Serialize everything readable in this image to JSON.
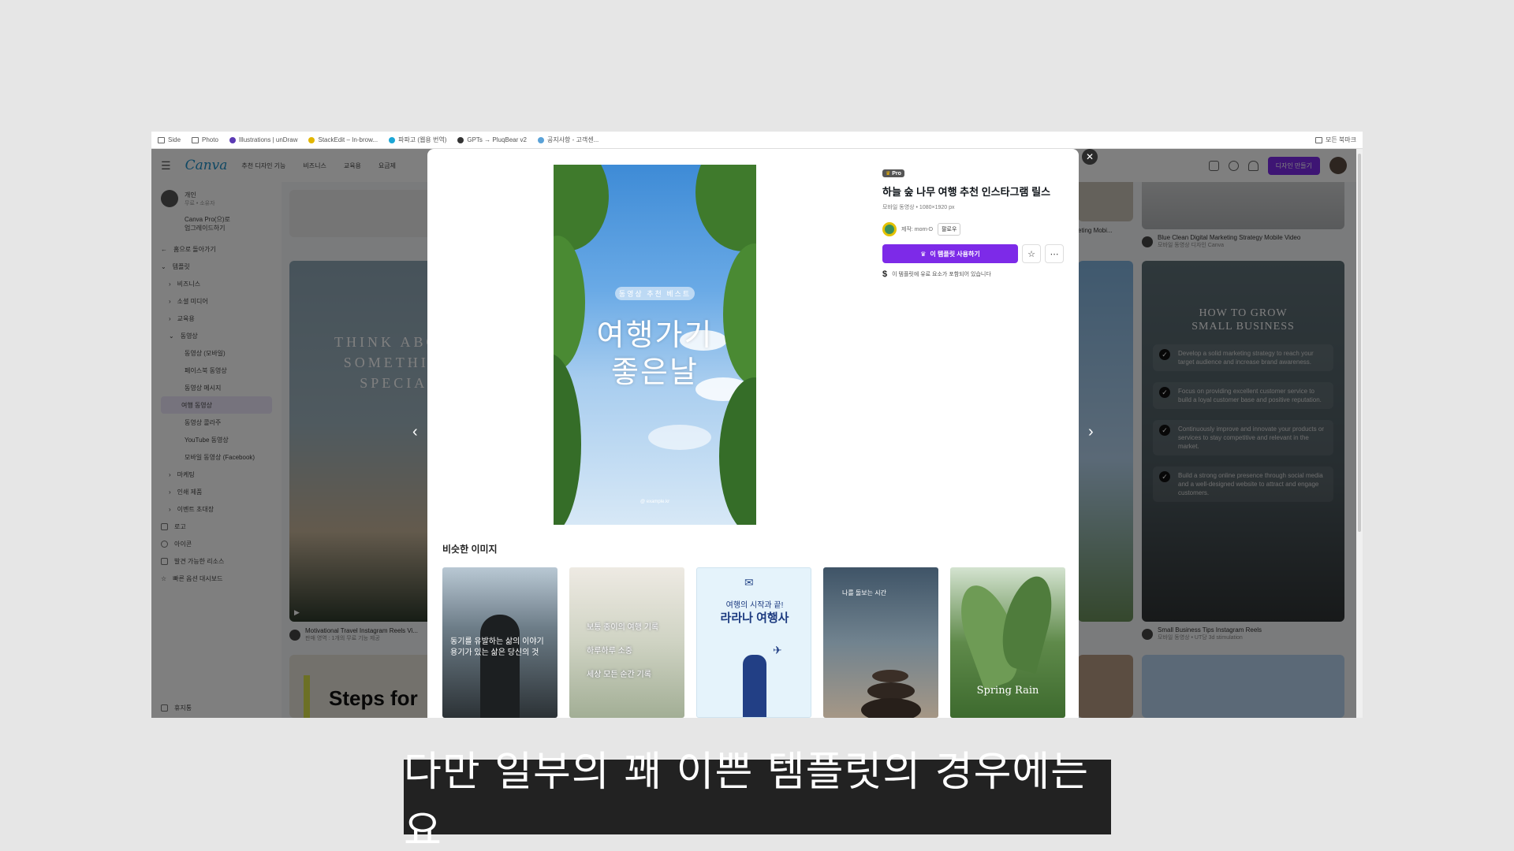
{
  "bookmarks": [
    {
      "label": "Side",
      "icon": "folder-icon"
    },
    {
      "label": "Photo",
      "icon": "folder-icon"
    },
    {
      "label": "Illustrations | unDraw",
      "icon": "undraw-icon"
    },
    {
      "label": "StackEdit – In-brow...",
      "icon": "stackedit-icon"
    },
    {
      "label": "파파고 (웹용 번역)",
      "icon": "papago-icon"
    },
    {
      "label": "GPTs → PluqBear v2",
      "icon": "globe-icon"
    },
    {
      "label": "공지사항 - 고객센...",
      "icon": "site-icon"
    }
  ],
  "bookmarks_other": "모든 북마크",
  "topbar": {
    "logo": "Canva",
    "nav": [
      "추천 디자인 기능",
      "비즈니스",
      "교육용",
      "요금제"
    ],
    "create_label": "디자인 만들기"
  },
  "sidebar": {
    "profile_name": "개인",
    "profile_sub": "무료 • 소유자",
    "upgrade": "Canva Pro(으)로\n업그레이드하기",
    "back": "홈으로 돌아가기",
    "items": [
      "템플릿",
      "비즈니스",
      "소셜 미디어",
      "교육용",
      "동영상",
      "동영상 (모바일)",
      "페이스북 동영상",
      "동영상 메시지",
      "여행 동영상",
      "동영상 콜라주",
      "YouTube 동영상",
      "모바일 동영상 (Facebook)",
      "마케팅",
      "인쇄 제품",
      "이벤트 초대장",
      "로고",
      "아이콘",
      "발견 가능한 리소스",
      "빠른 옵션 대시보드"
    ],
    "active_index": 8,
    "footer": "휴지통"
  },
  "background": {
    "think_text": "THINK ABOUT\nSOMETHING\nSPECIAL",
    "think_caption": "Motivational Travel Instagram Reels Vi...",
    "think_sub": "판매 영역 : 1개의 무료 기능 제공",
    "steps_text": "Steps for",
    "top_right_caption": "Blue Clean Digital Marketing Strategy Mobile Video",
    "top_right_sub": "모바일 동영상 디자인 Canva",
    "partial_caption": "eting Mobi...",
    "grow_title": "HOW TO GROW\nSMALL BUSINESS",
    "grow_items": [
      "Develop a solid marketing strategy to reach your target audience and increase brand awareness.",
      "Focus on providing excellent customer service to build a loyal customer base and positive reputation.",
      "Continuously improve and innovate your products or services to stay competitive and relevant in the market.",
      "Build a strong online presence through social media and a well-designed website to attract and engage customers."
    ],
    "grow_caption": "Small Business Tips Instagram Reels",
    "grow_sub": "모바일 동영상 • UT당 3d stimulation"
  },
  "modal": {
    "badge": "Pro",
    "title": "하늘 숲 나무 여행 추천 인스타그램 릴스",
    "meta": "모바일 동영상 • 1080×1920 px",
    "creator": "제작: morn-D",
    "follow": "팔로우",
    "use_button": "이 템플릿 사용하기",
    "notice": "이 템플릿에 유료 요소가 포함되어 있습니다",
    "preview_pill": "동영상 추천 베스트",
    "preview_line1": "여행가기",
    "preview_line2": "좋은날",
    "preview_handle": "@ example.kr",
    "similar_heading": "비슷한 이미지",
    "similar": [
      {
        "text": "동기를 유발하는 삶의 이야기\n용기가 있는 삶은 당신의 것"
      },
      {
        "text": "보통 종이의 여행 기록\n하루하루 소중\n세상 모든 순간 기록"
      },
      {
        "text1": "여행의 시작과 끝!",
        "text2": "라라나 여행사"
      },
      {
        "text": "나를 돌보는 시간"
      },
      {
        "text": "Spring Rain"
      }
    ]
  },
  "subtitle": "다만 일부의 꽤 이쁜 템플릿의 경우에는요",
  "colors": {
    "accent": "#7d2ae8",
    "canva_blue": "#1e90c8"
  }
}
